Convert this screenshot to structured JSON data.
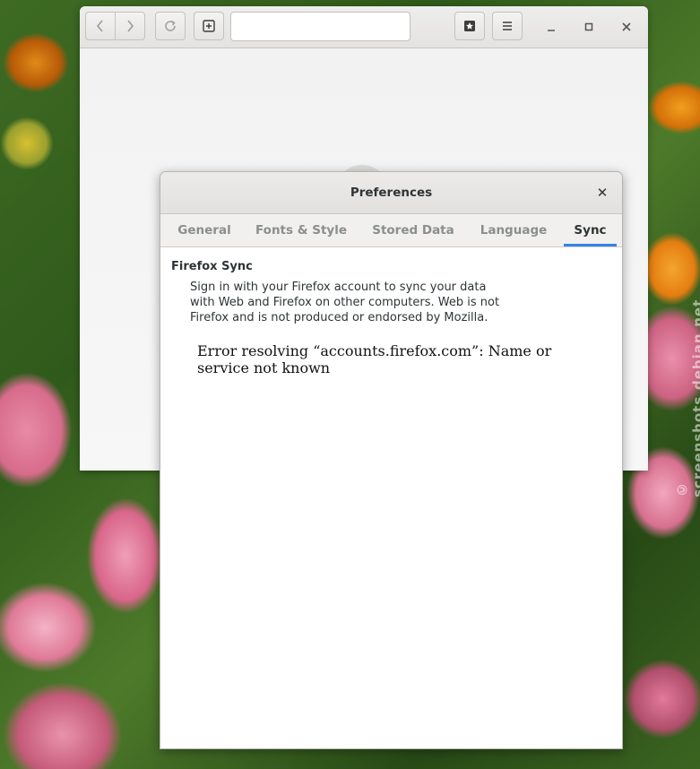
{
  "browser": {
    "url_value": "",
    "icons": {
      "back": "chevron-left-icon",
      "forward": "chevron-right-icon",
      "reload": "reload-icon",
      "new_tab": "new-tab-icon",
      "bookmarks": "bookmark-star-icon",
      "menu": "hamburger-menu-icon",
      "minimize": "minimize-icon",
      "maximize": "maximize-icon",
      "close": "close-icon"
    }
  },
  "dialog": {
    "title": "Preferences",
    "close_glyph": "✕",
    "tabs": [
      {
        "label": "General"
      },
      {
        "label": "Fonts & Style"
      },
      {
        "label": "Stored Data"
      },
      {
        "label": "Language"
      },
      {
        "label": "Sync"
      }
    ],
    "active_tab": "Sync",
    "sync": {
      "heading": "Firefox Sync",
      "description_lines": [
        "Sign in with your Firefox account to sync your data",
        "with Web and Firefox on other computers. Web is not",
        "Firefox and is not produced or endorsed by Mozilla."
      ],
      "error_lines": [
        "Error resolving “accounts.firefox.com”: Name or",
        "service not known"
      ]
    }
  },
  "watermark": "© screenshots.debian.net",
  "colors": {
    "accent": "#3584e4"
  }
}
